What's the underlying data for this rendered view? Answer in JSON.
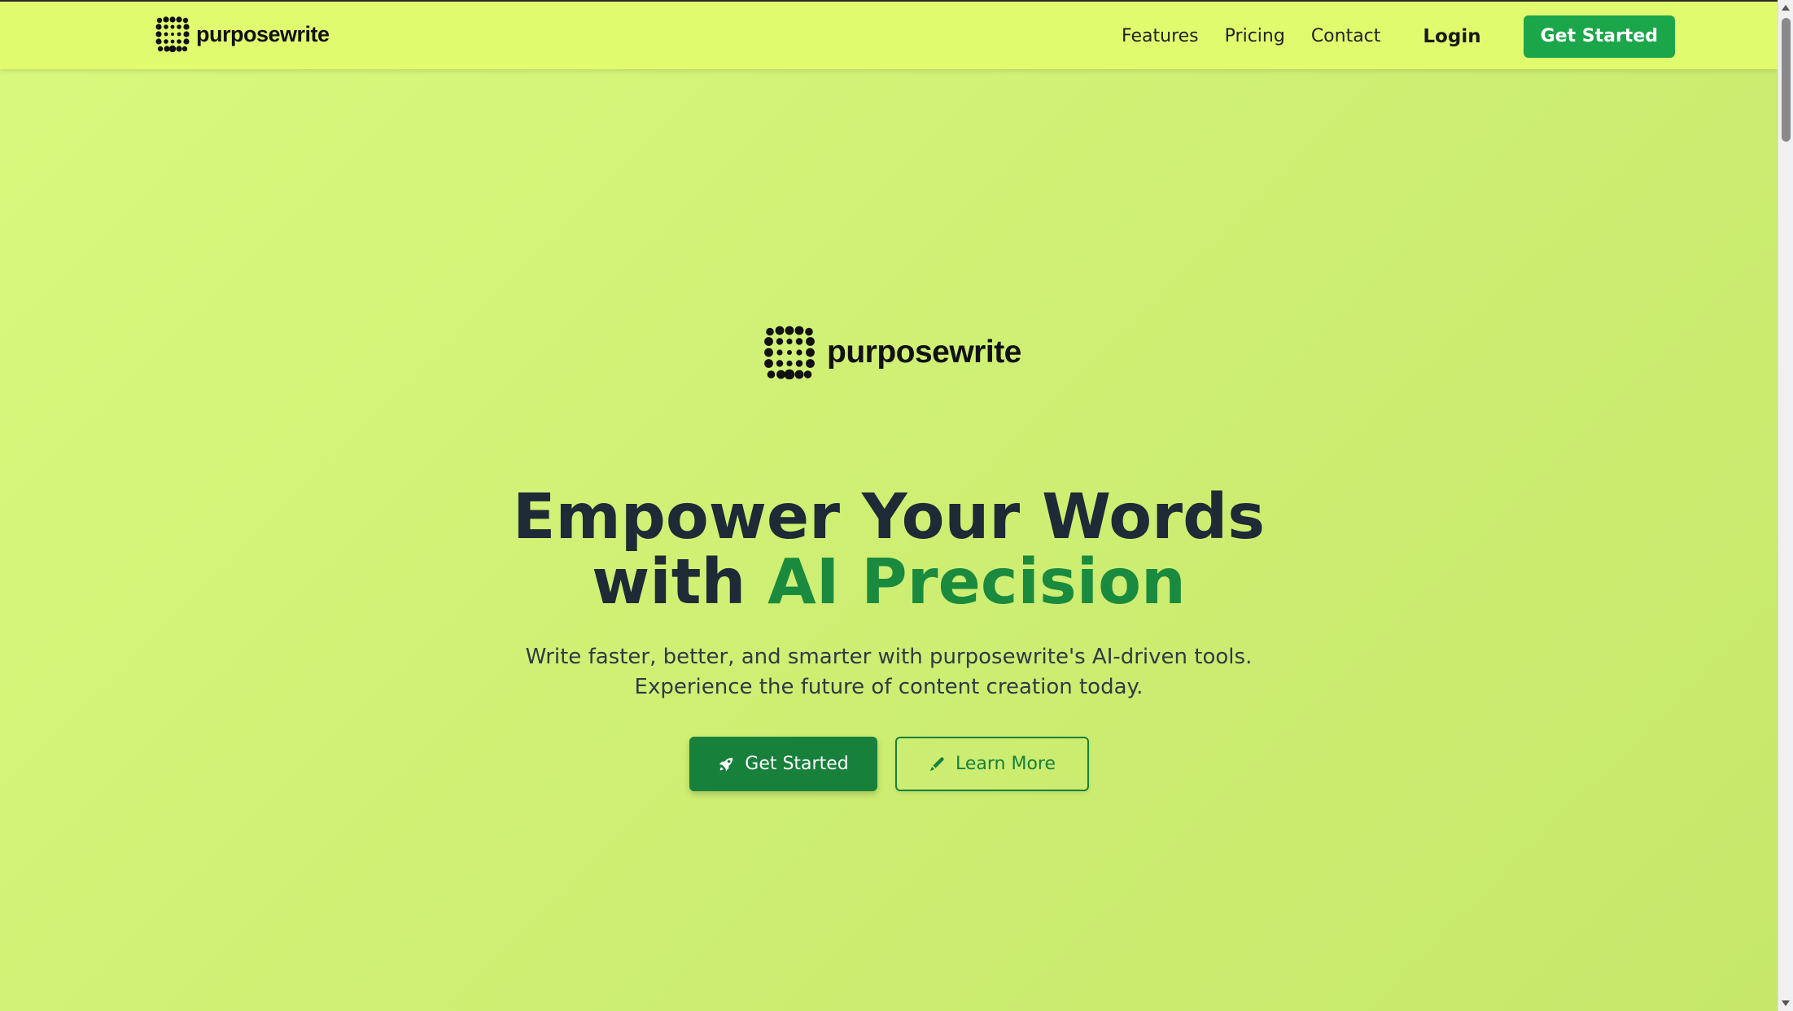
{
  "nav": {
    "brand": "purposewrite",
    "links": [
      "Features",
      "Pricing",
      "Contact"
    ],
    "login": "Login",
    "cta": "Get Started"
  },
  "hero": {
    "brand": "purposewrite",
    "headline_line1": "Empower Your Words",
    "headline_with": "with ",
    "headline_accent": "AI Precision",
    "subtitle": "Write faster, better, and smarter with purposewrite's AI-driven tools. Experience the future of content creation today.",
    "primary_button": "Get Started",
    "primary_icon": "rocket-icon",
    "secondary_button": "Learn More",
    "secondary_icon": "pen-icon"
  },
  "colors": {
    "nav_background": "#e1fb6f",
    "page_background": "#d4f276",
    "accent_green": "#1a8a3e",
    "cta_green": "#1ba64a",
    "headline_dark": "#1e2a36"
  }
}
